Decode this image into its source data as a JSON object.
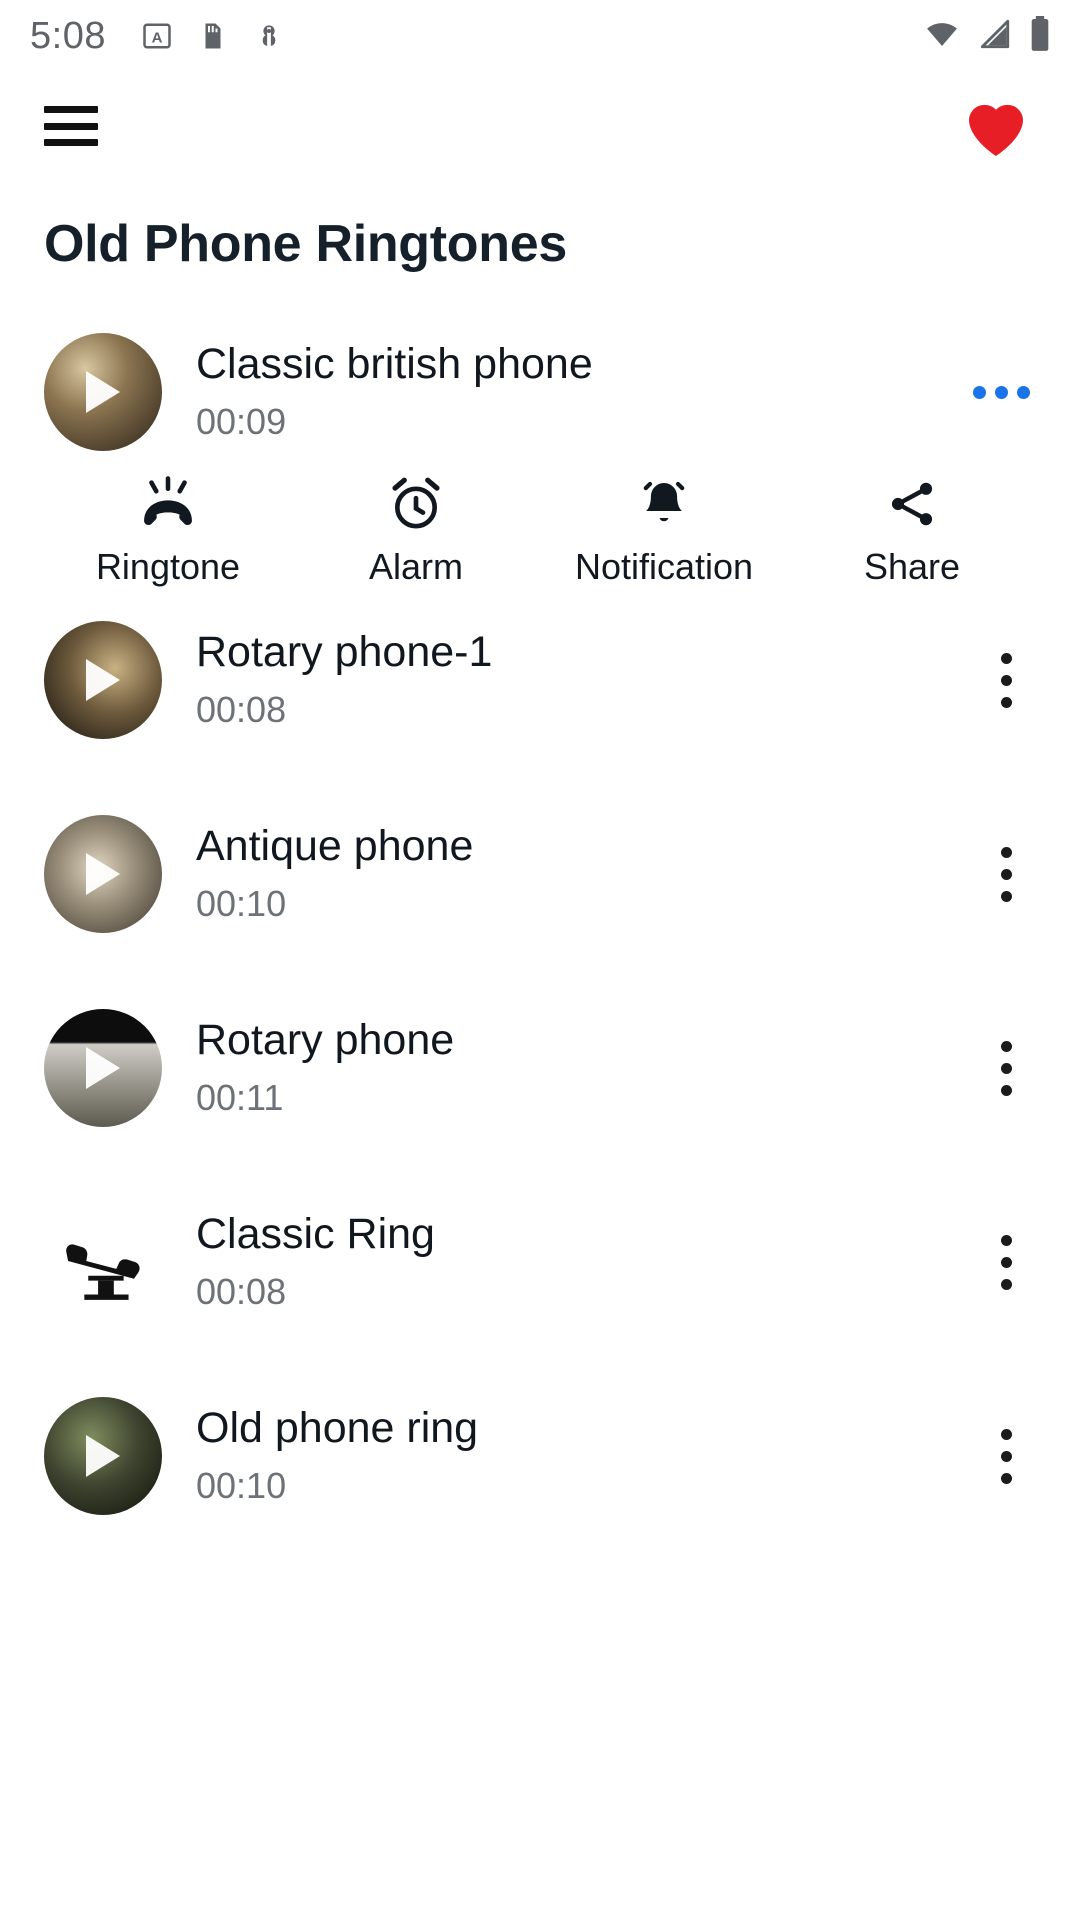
{
  "status_bar": {
    "time": "5:08",
    "left_icons": [
      "a-badge-icon",
      "sd-card-icon",
      "android-debug-icon"
    ],
    "right_icons": [
      "wifi-icon",
      "signal-icon",
      "battery-icon"
    ]
  },
  "app_bar": {
    "menu_icon": "hamburger-menu-icon",
    "favorite_icon": "heart-icon",
    "favorite_color": "#e81e26"
  },
  "page": {
    "title": "Old Phone Ringtones"
  },
  "expanded_actions": [
    {
      "label": "Ringtone",
      "icon": "phone-ringing-icon"
    },
    {
      "label": "Alarm",
      "icon": "alarm-clock-icon"
    },
    {
      "label": "Notification",
      "icon": "bell-icon"
    },
    {
      "label": "Share",
      "icon": "share-icon"
    }
  ],
  "ringtones": [
    {
      "title": "Classic british phone",
      "duration": "00:09",
      "expanded": true,
      "menu_icon": "more-horizontal-icon"
    },
    {
      "title": "Rotary phone-1",
      "duration": "00:08",
      "expanded": false,
      "menu_icon": "more-vertical-icon"
    },
    {
      "title": "Antique phone",
      "duration": "00:10",
      "expanded": false,
      "menu_icon": "more-vertical-icon"
    },
    {
      "title": "Rotary phone",
      "duration": "00:11",
      "expanded": false,
      "menu_icon": "more-vertical-icon"
    },
    {
      "title": "Classic Ring",
      "duration": "00:08",
      "expanded": false,
      "menu_icon": "more-vertical-icon"
    },
    {
      "title": "Old phone ring",
      "duration": "00:10",
      "expanded": false,
      "menu_icon": "more-vertical-icon"
    }
  ]
}
